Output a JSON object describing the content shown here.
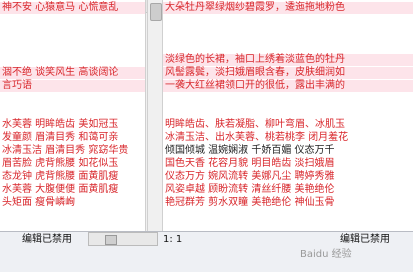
{
  "left_pane": {
    "lines": [
      {
        "text": "神不安  心猿意马  心慌意乱",
        "style": "red pink"
      },
      {
        "text": "",
        "style": "pink"
      },
      {
        "text": "",
        "style": ""
      },
      {
        "text": "",
        "style": "pink"
      },
      {
        "text": "",
        "style": "pink"
      },
      {
        "text": "涸不绝  谈笑风生  高谈阔论",
        "style": "red pink"
      },
      {
        "text": "言巧语",
        "style": "red pink"
      },
      {
        "text": "",
        "style": "pink"
      },
      {
        "text": "",
        "style": ""
      },
      {
        "text": "水芙蓉  明眸皓齿  美如冠玉",
        "style": "red"
      },
      {
        "text": "发童颜  眉清目秀  和蔼可亲",
        "style": "red"
      },
      {
        "text": "冰清玉洁  眉清目秀  窕窈华贵",
        "style": "red"
      },
      {
        "text": "眉苦脸  虎背熊腰  如花似玉",
        "style": "red"
      },
      {
        "text": "态龙钟  虎背熊腰  面黄肌瘦",
        "style": "red"
      },
      {
        "text": "水芙蓉  大腹便便  面黄肌瘦",
        "style": "red"
      },
      {
        "text": "头矩面  瘦骨嶙峋",
        "style": "red"
      }
    ]
  },
  "right_pane": {
    "lines": [
      {
        "text": "大朵牡丹翠绿烟纱碧霞罗，逶迤拖地粉色",
        "style": "red pink"
      },
      {
        "text": "",
        "style": "pink"
      },
      {
        "text": "",
        "style": ""
      },
      {
        "text": "",
        "style": "pink"
      },
      {
        "text": "淡绿色的长裙，袖口上绣着淡蓝色的牡丹",
        "style": "red pink"
      },
      {
        "text": "风髻露鬓，淡扫娥眉眼含春，皮肤细润如",
        "style": "red pink"
      },
      {
        "text": "一袭大红丝裙领口开的很低，露出丰满的",
        "style": "red pink"
      },
      {
        "text": "",
        "style": "pink"
      },
      {
        "text": "",
        "style": ""
      },
      {
        "text": "明眸皓齿、肤若凝脂、柳叶弯眉、冰肌玉",
        "style": "red"
      },
      {
        "text": "冰清玉洁、出水芙蓉、桃若桃李  闭月羞花",
        "style": "red"
      },
      {
        "text": "倾国倾城  温婉娴淑  千娇百媚  仪态万千",
        "style": "black"
      },
      {
        "text": "国色天香  花容月貌  明目皓齿  淡扫娥眉",
        "style": "red"
      },
      {
        "text": "仪态万方  婉风流转  美娜凡尘  聘婷秀雅",
        "style": "red"
      },
      {
        "text": "风姿卓越  顾盼流转  清丝纤腰  美艳绝伦",
        "style": "red"
      },
      {
        "text": "艳冠群芳  剪水双瞳  美艳绝伦  神仙玉骨",
        "style": "red"
      }
    ]
  },
  "status_bar": {
    "left_label": "编辑已禁用",
    "position": "1: 1",
    "right_label": "编辑已禁用"
  },
  "watermark": "Baidu 经验"
}
